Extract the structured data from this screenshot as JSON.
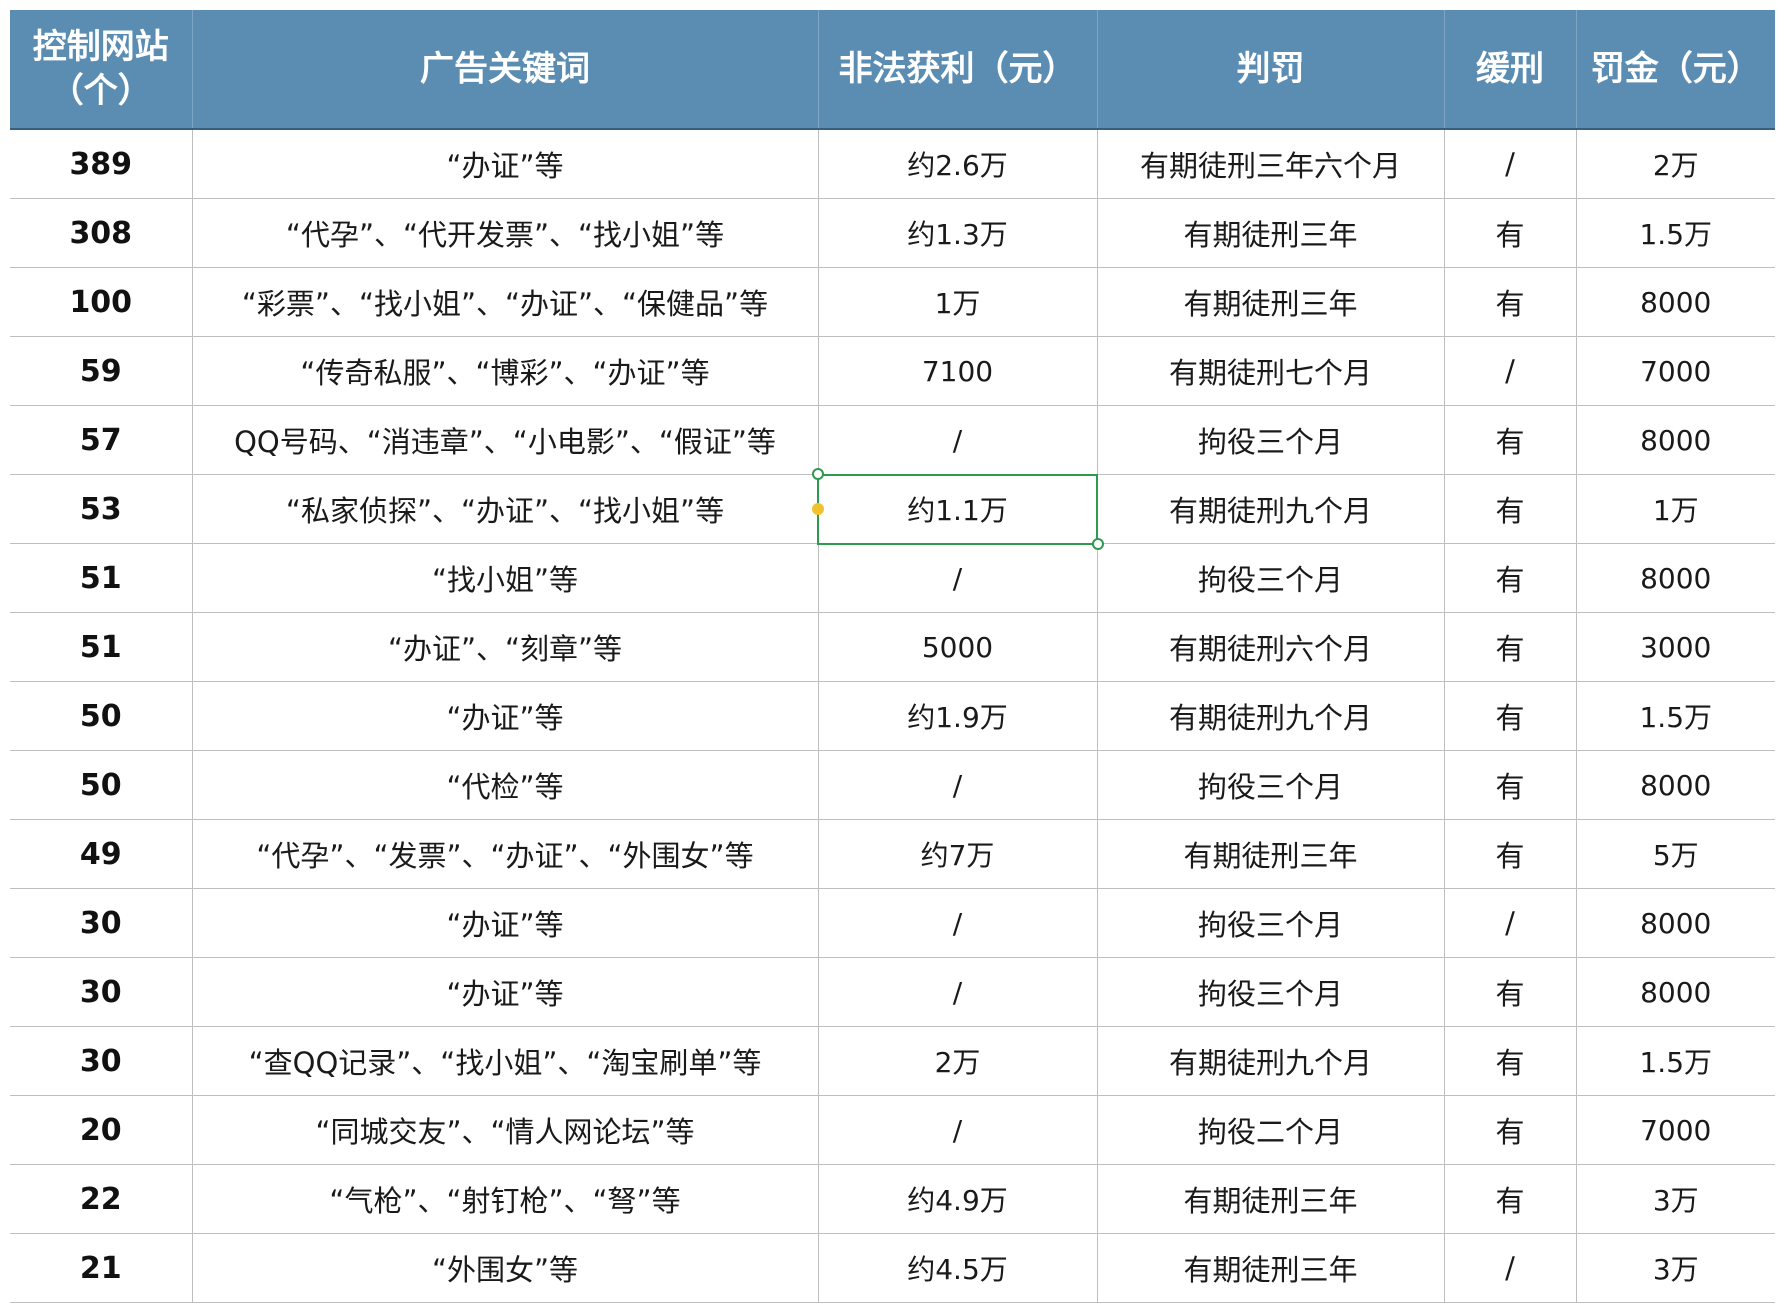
{
  "header": {
    "col_sites_line1": "控制网站",
    "col_sites_line2": "（个）",
    "col_keywords": "广告关键词",
    "col_profit": "非法获利（元）",
    "col_sentence": "判罚",
    "col_probation": "缓刑",
    "col_fine": "罚金（元）"
  },
  "rows": [
    {
      "sites": "389",
      "keywords": "“办证”等",
      "profit": "约2.6万",
      "sentence": "有期徒刑三年六个月",
      "probation": "/",
      "fine": "2万"
    },
    {
      "sites": "308",
      "keywords": "“代孕”、“代开发票”、“找小姐”等",
      "profit": "约1.3万",
      "sentence": "有期徒刑三年",
      "probation": "有",
      "fine": "1.5万"
    },
    {
      "sites": "100",
      "keywords": "“彩票”、“找小姐”、“办证”、“保健品”等",
      "profit": "1万",
      "sentence": "有期徒刑三年",
      "probation": "有",
      "fine": "8000"
    },
    {
      "sites": "59",
      "keywords": "“传奇私服”、“博彩”、“办证”等",
      "profit": "7100",
      "sentence": "有期徒刑七个月",
      "probation": "/",
      "fine": "7000"
    },
    {
      "sites": "57",
      "keywords": "QQ号码、“消违章”、“小电影”、“假证”等",
      "profit": "/",
      "sentence": "拘役三个月",
      "probation": "有",
      "fine": "8000"
    },
    {
      "sites": "53",
      "keywords": "“私家侦探”、“办证”、“找小姐”等",
      "profit": "约1.1万",
      "sentence": "有期徒刑九个月",
      "probation": "有",
      "fine": "1万"
    },
    {
      "sites": "51",
      "keywords": "“找小姐”等",
      "profit": "/",
      "sentence": "拘役三个月",
      "probation": "有",
      "fine": "8000"
    },
    {
      "sites": "51",
      "keywords": "“办证”、“刻章”等",
      "profit": "5000",
      "sentence": "有期徒刑六个月",
      "probation": "有",
      "fine": "3000"
    },
    {
      "sites": "50",
      "keywords": "“办证”等",
      "profit": "约1.9万",
      "sentence": "有期徒刑九个月",
      "probation": "有",
      "fine": "1.5万"
    },
    {
      "sites": "50",
      "keywords": "“代检”等",
      "profit": "/",
      "sentence": "拘役三个月",
      "probation": "有",
      "fine": "8000"
    },
    {
      "sites": "49",
      "keywords": "“代孕”、“发票”、“办证”、“外围女”等",
      "profit": "约7万",
      "sentence": "有期徒刑三年",
      "probation": "有",
      "fine": "5万"
    },
    {
      "sites": "30",
      "keywords": "“办证”等",
      "profit": "/",
      "sentence": "拘役三个月",
      "probation": "/",
      "fine": "8000"
    },
    {
      "sites": "30",
      "keywords": "“办证”等",
      "profit": "/",
      "sentence": "拘役三个月",
      "probation": "有",
      "fine": "8000"
    },
    {
      "sites": "30",
      "keywords": "“查QQ记录”、“找小姐”、“淘宝刷单”等",
      "profit": "2万",
      "sentence": "有期徒刑九个月",
      "probation": "有",
      "fine": "1.5万"
    },
    {
      "sites": "20",
      "keywords": "“同城交友”、“情人网论坛”等",
      "profit": "/",
      "sentence": "拘役二个月",
      "probation": "有",
      "fine": "7000"
    },
    {
      "sites": "22",
      "keywords": "“气枪”、“射钉枪”、“弩”等",
      "profit": "约4.9万",
      "sentence": "有期徒刑三年",
      "probation": "有",
      "fine": "3万"
    },
    {
      "sites": "21",
      "keywords": "“外围女”等",
      "profit": "约4.5万",
      "sentence": "有期徒刑三年",
      "probation": "/",
      "fine": "3万"
    }
  ]
}
